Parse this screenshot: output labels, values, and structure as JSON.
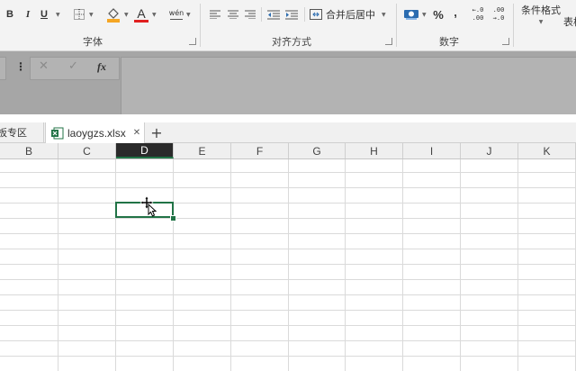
{
  "ribbon": {
    "font_group": {
      "label": "字体",
      "bold": "B",
      "italic": "I",
      "underline": "U",
      "font_color_glyph": "A",
      "phonetic": "wén"
    },
    "align_group": {
      "label": "对齐方式",
      "merge_center": "合并后居中"
    },
    "number_group": {
      "label": "数字",
      "percent": "%",
      "comma": ",",
      "inc_decimal": "←.0\n.00",
      "dec_decimal": ".00\n→.0"
    },
    "styles_group": {
      "conditional_format": "条件格式",
      "table_format": "表格"
    },
    "colors": {
      "fill_accent": "#f5a623",
      "font_accent": "#e02020",
      "accent": "#217346"
    }
  },
  "formula_bar": {
    "cancel": "✕",
    "enter": "✓",
    "fx": "fx",
    "value": ""
  },
  "tabs": {
    "template_tab": "模板专区",
    "file_tab": "laoygzs.xlsx",
    "close": "✕",
    "add": "+"
  },
  "columns": [
    "B",
    "C",
    "D",
    "E",
    "F",
    "G",
    "H",
    "I",
    "J",
    "K"
  ],
  "selected_column": "D"
}
